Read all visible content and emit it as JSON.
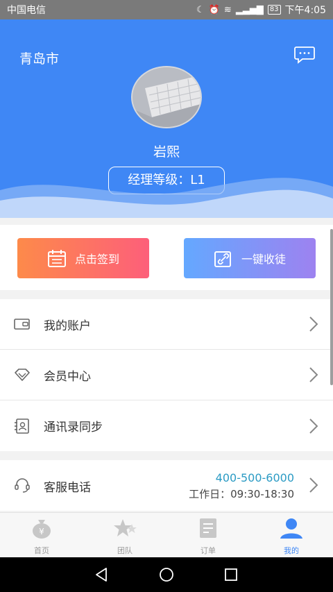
{
  "status_bar": {
    "carrier": "中国电信",
    "battery": "83",
    "time": "下午4:05"
  },
  "header": {
    "city": "青岛市",
    "username": "岩熙",
    "level": "经理等级：L1"
  },
  "actions": {
    "signin": "点击签到",
    "collect": "一键收徒"
  },
  "menu": [
    {
      "label": "我的账户",
      "icon": "wallet-icon"
    },
    {
      "label": "会员中心",
      "icon": "diamond-icon"
    },
    {
      "label": "通讯录同步",
      "icon": "contacts-icon"
    }
  ],
  "service": {
    "label": "客服电话",
    "phone": "400-500-6000",
    "hours": "工作日：09:30-18:30"
  },
  "tabs": [
    {
      "label": "首页",
      "icon": "money-bag-icon"
    },
    {
      "label": "团队",
      "icon": "stars-icon"
    },
    {
      "label": "订单",
      "icon": "document-icon"
    },
    {
      "label": "我的",
      "icon": "user-icon",
      "active": true
    }
  ],
  "colors": {
    "primary": "#3f87f5",
    "signin_gradient": [
      "#fd8a4a",
      "#fd5f7a"
    ],
    "collect_gradient": [
      "#64a8ff",
      "#9d82f0"
    ],
    "phone": "#2b9bc4"
  }
}
